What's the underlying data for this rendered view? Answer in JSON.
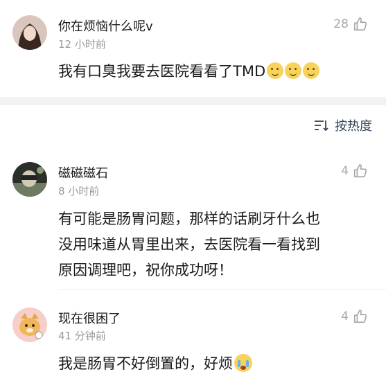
{
  "post": {
    "username": "你在烦恼什么呢v",
    "time": "12 小时前",
    "content": "我有口臭我要去医院看看了TMD",
    "emojis": [
      "thinking-emoji",
      "thinking-emoji",
      "thinking-emoji"
    ],
    "likes": "28"
  },
  "sort": {
    "label": "按热度",
    "icon": "sort-icon"
  },
  "comments": [
    {
      "username": "磁磁磁石",
      "time": "8 小时前",
      "lines": [
        "有可能是肠胃问题，那样的话刷牙什么也",
        "没用味道从胃里出来，去医院看一看找到",
        "原因调理吧，祝你成功呀！"
      ],
      "likes": "4"
    },
    {
      "username": "现在很困了",
      "time": "41 分钟前",
      "lines": [
        "我是肠胃不好倒置的，好烦"
      ],
      "emoji": "crying-emoji",
      "likes": "4"
    }
  ],
  "colors": {
    "accent": "#33445c",
    "muted": "#9a9a9a",
    "band": "#f2f2f2"
  }
}
